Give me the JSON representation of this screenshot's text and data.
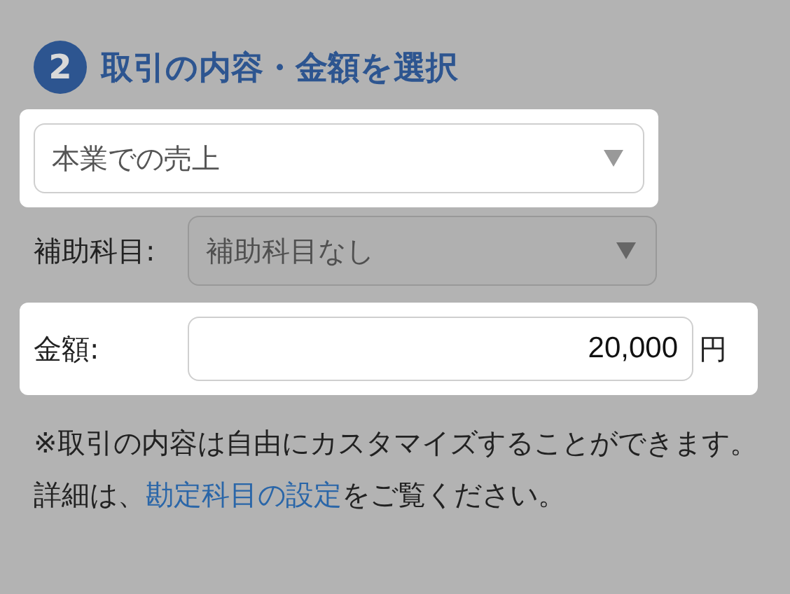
{
  "section": {
    "number": "2",
    "title": "取引の内容・金額を選択"
  },
  "transaction_select": {
    "value": "本業での売上",
    "highlighted": true,
    "disabled": false
  },
  "sub_account": {
    "label": "補助科目:",
    "value": "補助科目なし",
    "highlighted": false,
    "disabled": true
  },
  "amount": {
    "label": "金額:",
    "value": "20,000",
    "unit": "円",
    "highlighted": true
  },
  "note": {
    "before": "※取引の内容は自由にカスタマイズすることができます。詳細は、",
    "link": "勘定科目の設定",
    "after": "をご覧ください。"
  }
}
